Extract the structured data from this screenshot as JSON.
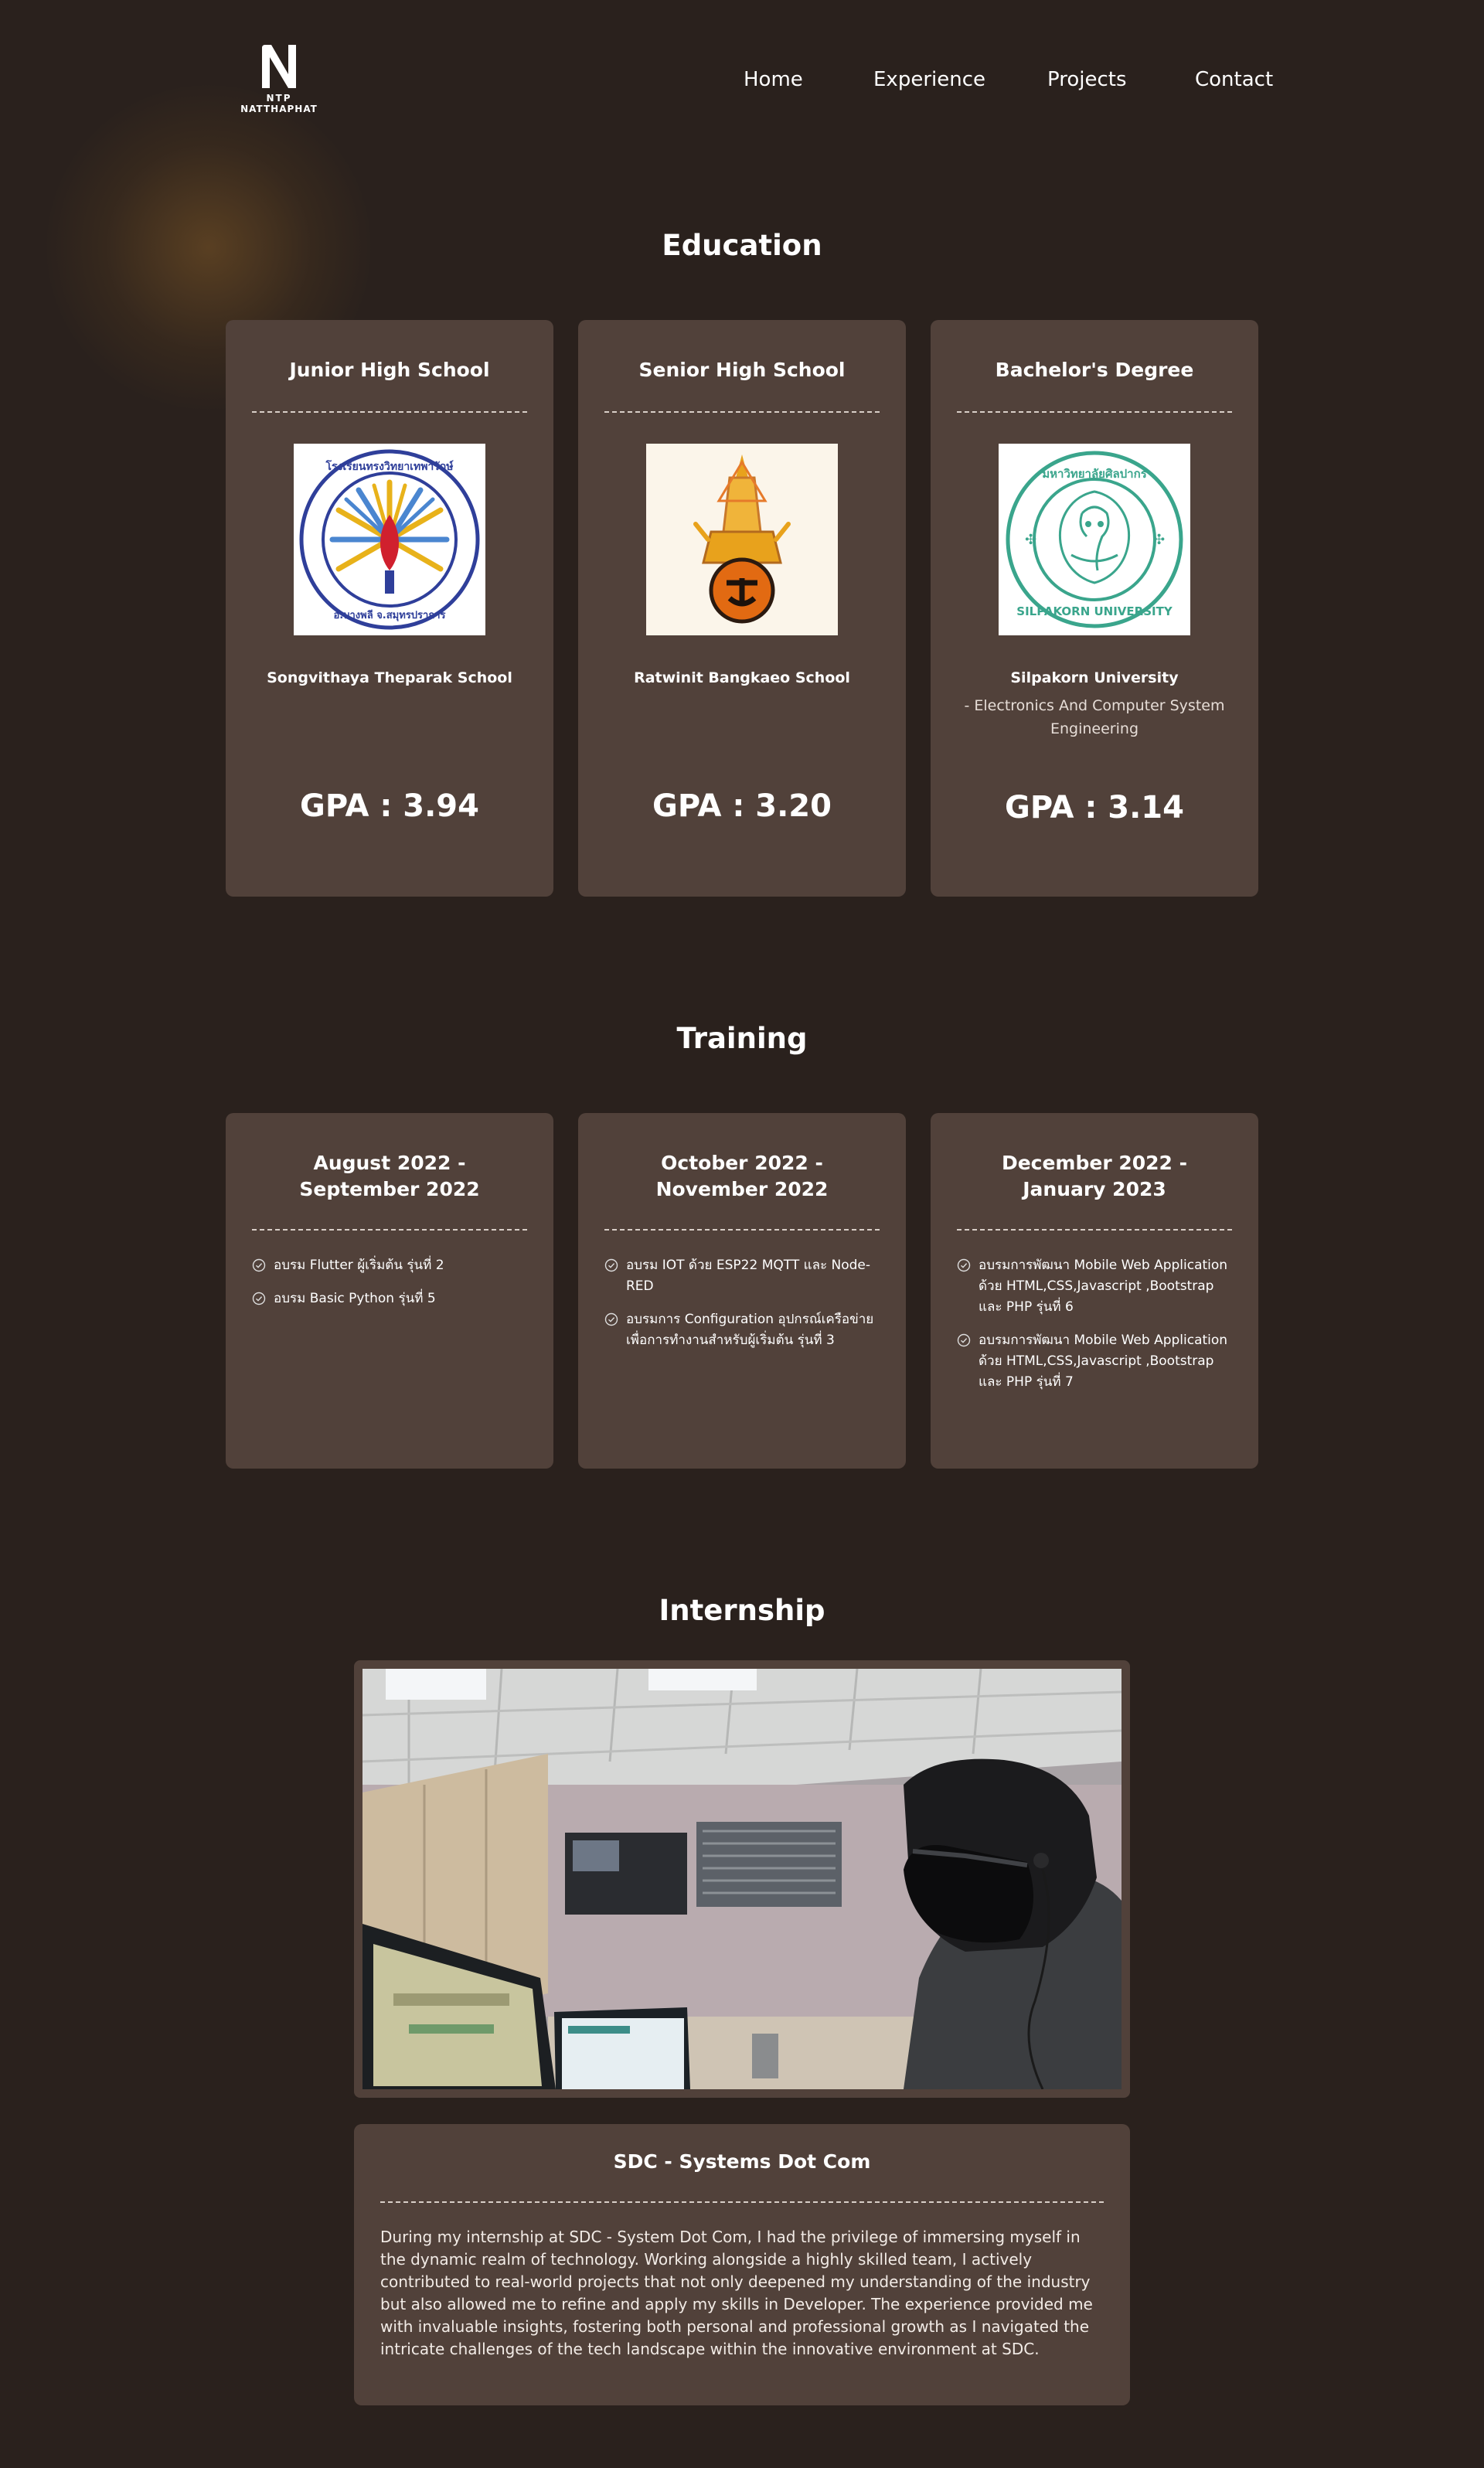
{
  "brand": {
    "initial": "N",
    "line1": "NTP",
    "line2": "NATTHAPHAT"
  },
  "nav": {
    "items": [
      "Home",
      "Experience",
      "Projects",
      "Contact"
    ]
  },
  "education": {
    "title": "Education",
    "cards": [
      {
        "level": "Junior High School",
        "school": "Songvithaya Theparak School",
        "major": "",
        "gpa": "GPA : 3.94"
      },
      {
        "level": "Senior High School",
        "school": "Ratwinit Bangkaeo School",
        "major": "",
        "gpa": "GPA : 3.20"
      },
      {
        "level": "Bachelor's Degree",
        "school": "Silpakorn University",
        "major": "- Electronics And Computer System Engineering",
        "gpa": "GPA : 3.14"
      }
    ]
  },
  "training": {
    "title": "Training",
    "cards": [
      {
        "period_line1": "August 2022 -",
        "period_line2": "September 2022",
        "items": [
          "อบรม Flutter ผู้เริ่มต้น รุ่นที่ 2",
          "อบรม Basic Python รุ่นที่ 5"
        ]
      },
      {
        "period_line1": "October 2022 -",
        "period_line2": "November 2022",
        "items": [
          "อบรม IOT ด้วย ESP22 MQTT และ Node-RED",
          "อบรมการ Configuration อุปกรณ์เครือข่ายเพื่อการทำงานสำหรับผู้เริ่มต้น รุ่นที่ 3"
        ]
      },
      {
        "period_line1": "December 2022 -",
        "period_line2": "January 2023",
        "items": [
          "อบรมการพัฒนา Mobile Web Application ด้วย HTML,CSS,Javascript ,Bootstrap และ PHP รุ่นที่ 6",
          "อบรมการพัฒนา Mobile Web Application ด้วย HTML,CSS,Javascript ,Bootstrap และ PHP รุ่นที่ 7"
        ]
      }
    ]
  },
  "internship": {
    "title": "Internship",
    "company": "SDC - Systems Dot Com",
    "description": "During my internship at SDC - System Dot Com, I had the privilege of immersing myself in the dynamic realm of technology. Working alongside a highly skilled team, I actively contributed to real-world projects that not only deepened my understanding of the industry but also allowed me to refine and apply my skills in Developer. The experience provided me with invaluable insights, fostering both personal and professional growth as I navigated the intricate challenges of the tech landscape within the innovative environment at SDC."
  },
  "seal_text": {
    "junior": "โรงเรียนทรงวิทยาเทพารักษ์ อ.บางพลี จ.สมุทรปราการ",
    "bachelor": "มหาวิทยาลัยศิลปากร SILPAKORN UNIVERSITY"
  },
  "colors": {
    "background": "#2a211d",
    "card": "#51413a",
    "text": "#ffffff",
    "seal_blue": "#2f3f9a",
    "seal_green": "#3aa58c"
  }
}
